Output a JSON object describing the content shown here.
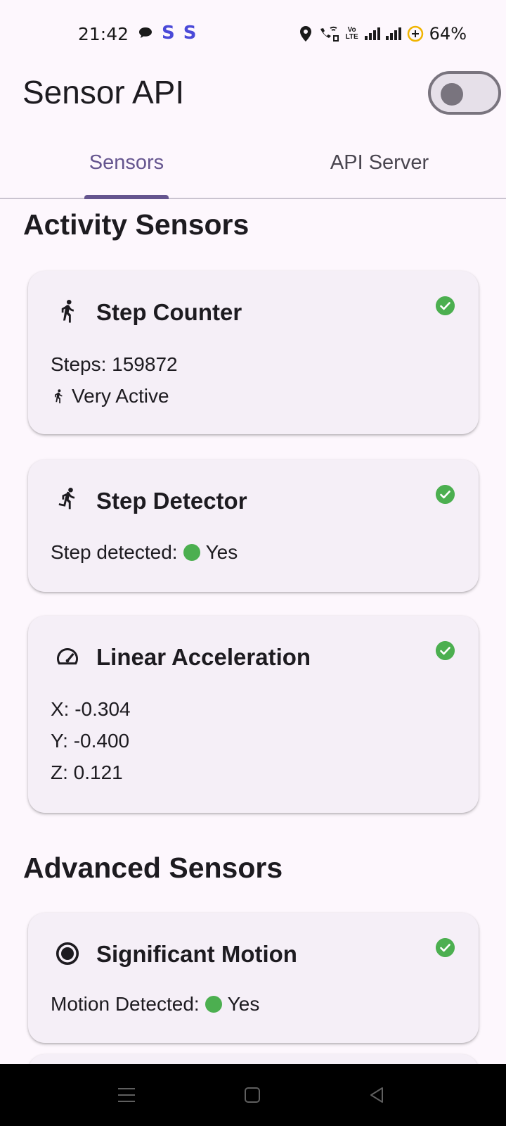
{
  "status_bar": {
    "time": "21:42",
    "battery": "64%",
    "volte": "Vo LTE",
    "icons": [
      "chat-bubble-icon",
      "s-app-icon",
      "s-app-icon",
      "location-icon",
      "wifi-call-icon",
      "volte-icon",
      "signal-icon",
      "signal-icon",
      "battery-saver-icon"
    ]
  },
  "app": {
    "title": "Sensor API",
    "toggle_on": false
  },
  "tabs": [
    {
      "label": "Sensors",
      "active": true
    },
    {
      "label": "API Server",
      "active": false
    }
  ],
  "sections": [
    {
      "title": "Activity Sensors"
    },
    {
      "title": "Advanced Sensors"
    }
  ],
  "cards": {
    "step_counter": {
      "title": "Step Counter",
      "icon": "walk-icon",
      "steps": "Steps: 159872",
      "activity": "Very Active"
    },
    "step_detector": {
      "title": "Step Detector",
      "icon": "run-icon",
      "label": "Step detected:",
      "value": "Yes"
    },
    "linear_acceleration": {
      "title": "Linear Acceleration",
      "icon": "speedometer-icon",
      "x": "X: -0.304",
      "y": "Y: -0.400",
      "z": "Z: 0.121"
    },
    "significant_motion": {
      "title": "Significant Motion",
      "icon": "record-icon",
      "label": "Motion Detected:",
      "value": "Yes"
    }
  },
  "colors": {
    "background": "#fdf7fd",
    "accent": "#65558f",
    "card": "#f5eff7",
    "ok_green": "#4caf50"
  }
}
